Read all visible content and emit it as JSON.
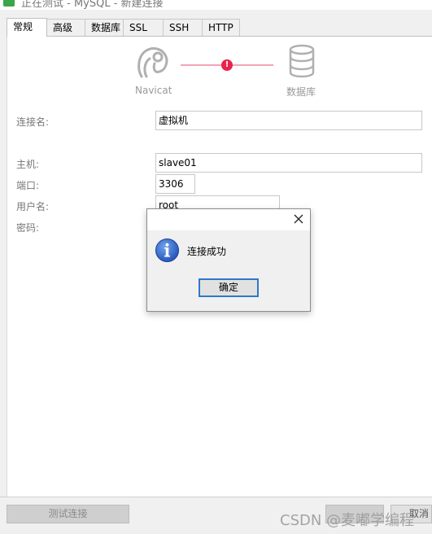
{
  "window": {
    "title": "正在测试 - MySQL - 新建连接"
  },
  "tabs": [
    {
      "label": "常规",
      "active": true
    },
    {
      "label": "高级"
    },
    {
      "label": "数据库"
    },
    {
      "label": "SSL"
    },
    {
      "label": "SSH"
    },
    {
      "label": "HTTP"
    }
  ],
  "diagram": {
    "client_label": "Navicat",
    "client_icon": "navicat-logo-icon",
    "status_icon": "error-icon",
    "server_label": "数据库",
    "server_icon": "database-icon",
    "line_color": "#f2a3b5",
    "status_color": "#e8234d"
  },
  "form": {
    "connection_name_label": "连接名:",
    "connection_name_value": "虚拟机",
    "host_label": "主机:",
    "host_value": "slave01",
    "port_label": "端口:",
    "port_value": "3306",
    "username_label": "用户名:",
    "username_value": "root",
    "password_label": "密码:"
  },
  "footer": {
    "test_connection_label": "测试连接",
    "cancel_label": "取消"
  },
  "dialog": {
    "icon": "info-icon",
    "message": "连接成功",
    "ok_label": "确定",
    "accent_color": "#2e79c8"
  },
  "watermark": "CSDN @麦嘟学编程"
}
